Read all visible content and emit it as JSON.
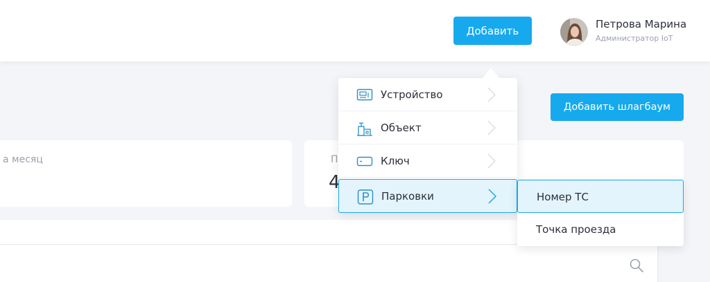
{
  "header": {
    "add_button": "Добавить",
    "user": {
      "name": "Петрова Марина",
      "role": "Администратор IoT"
    }
  },
  "toolbar": {
    "add_barrier_button": "Добавить шлагбаум"
  },
  "stats": [
    {
      "label": "а месяц",
      "value": ""
    },
    {
      "label": "П",
      "value": "4"
    }
  ],
  "dropdown": {
    "items": [
      {
        "label": "Устройство",
        "icon": "device-icon"
      },
      {
        "label": "Объект",
        "icon": "building-icon"
      },
      {
        "label": "Ключ",
        "icon": "key-card-icon"
      },
      {
        "label": "Парковки",
        "icon": "parking-icon",
        "active": true
      }
    ],
    "submenu": [
      {
        "label": "Номер ТС",
        "active": true
      },
      {
        "label": "Точка проезда"
      }
    ]
  },
  "colors": {
    "accent": "#17a9ee",
    "active_bg": "#e4f4fc",
    "background": "#f4f5f9"
  }
}
